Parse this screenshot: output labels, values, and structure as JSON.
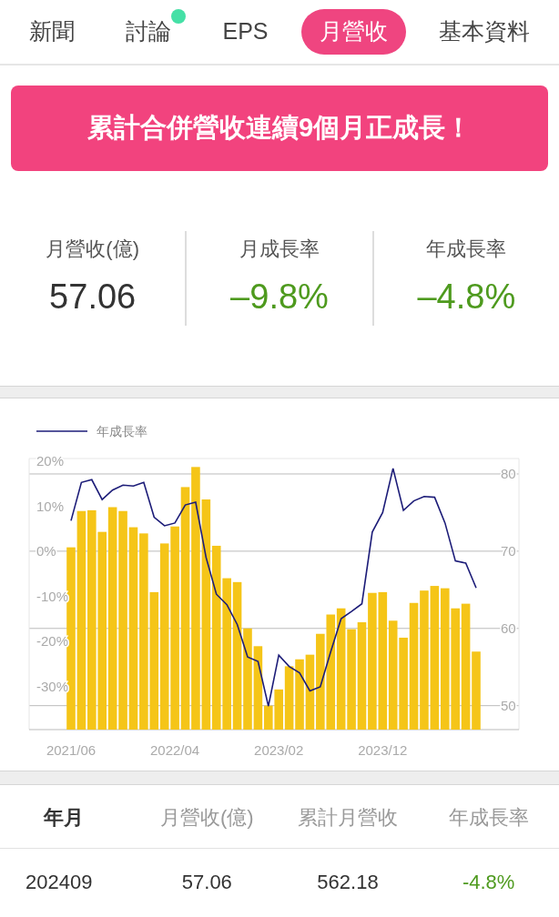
{
  "tabs": [
    {
      "label": "新聞",
      "selected": false,
      "dot": false
    },
    {
      "label": "討論",
      "selected": false,
      "dot": true
    },
    {
      "label": "EPS",
      "selected": false,
      "dot": false
    },
    {
      "label": "月營收",
      "selected": true,
      "dot": false
    },
    {
      "label": "基本資料",
      "selected": false,
      "dot": false
    }
  ],
  "banner": "累計合併營收連續9個月正成長！",
  "stats": [
    {
      "label": "月營收(億)",
      "value": "57.06",
      "color": "#333333"
    },
    {
      "label": "月成長率",
      "value": "–9.8%",
      "color": "#4e9a1e"
    },
    {
      "label": "年成長率",
      "value": "–4.8%",
      "color": "#4e9a1e"
    }
  ],
  "chart": {
    "chart_data": {
      "type": "bar",
      "categories": [
        "2021/06",
        null,
        null,
        null,
        null,
        null,
        null,
        null,
        null,
        null,
        "2022/04",
        null,
        null,
        null,
        null,
        null,
        null,
        null,
        null,
        null,
        "2023/02",
        null,
        null,
        null,
        null,
        null,
        null,
        null,
        null,
        null,
        "2023/12",
        null,
        null,
        null,
        null,
        null,
        null,
        null,
        null,
        null
      ],
      "series": [
        {
          "color": "#f5c518",
          "axis": "y2",
          "values": [
            70.5,
            75.2,
            75.3,
            72.5,
            75.7,
            75.2,
            73.1,
            72.3,
            64.7,
            71.0,
            73.2,
            78.3,
            80.9,
            76.7,
            70.7,
            66.5,
            66.0,
            60.0,
            57.7,
            50.0,
            52.1,
            55.1,
            56.0,
            56.6,
            59.3,
            61.8,
            62.6,
            59.9,
            60.8,
            64.6,
            64.7,
            61.0,
            58.8,
            63.3,
            64.9,
            65.5,
            65.2,
            62.6,
            63.2,
            57.0
          ]
        },
        {
          "name": "年成長率",
          "color": "#1c1c78",
          "type": "line",
          "values": [
            6.8,
            15.3,
            15.9,
            11.5,
            13.6,
            14.7,
            14.5,
            15.3,
            7.6,
            5.7,
            6.3,
            10.3,
            10.9,
            -1.3,
            -9.5,
            -11.8,
            -16.2,
            -23.4,
            -24.4,
            -34.3,
            -23.0,
            -25.5,
            -26.9,
            -30.9,
            -30.0,
            -22.2,
            -14.9,
            -13.3,
            -11.6,
            4.3,
            8.6,
            18.4,
            9.1,
            11.2,
            12.2,
            12.0,
            6.3,
            -2.1,
            -2.6,
            -8.1
          ]
        }
      ],
      "ylim": [
        -39.5,
        20.6
      ],
      "yticks": [
        {
          "value": 20,
          "label": "20%"
        },
        {
          "value": 10,
          "label": "10%"
        },
        {
          "value": 0,
          "label": "0%"
        },
        {
          "value": -10,
          "label": "-10%"
        },
        {
          "value": -20,
          "label": "-20%"
        },
        {
          "value": -30,
          "label": "-30%"
        }
      ],
      "y2lim": [
        46.9,
        82
      ],
      "grid": true,
      "y2ticks": [
        80,
        70,
        60,
        50
      ]
    }
  },
  "table": {
    "columns": [
      "年月",
      "月營收(億)",
      "累計月營收",
      "年成長率"
    ],
    "rows": [
      {
        "cells": [
          "202409",
          "57.06",
          "562.18",
          "-4.8%"
        ],
        "color": "#4e9a1e"
      }
    ]
  }
}
